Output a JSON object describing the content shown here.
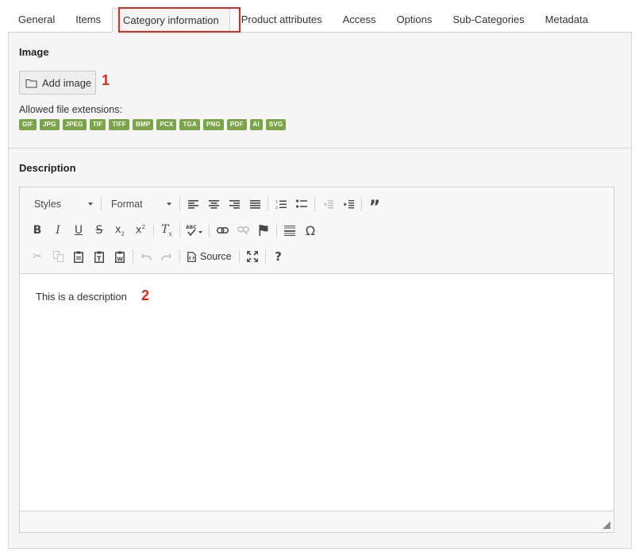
{
  "tabs": [
    {
      "label": "General"
    },
    {
      "label": "Items"
    },
    {
      "label": "Category information"
    },
    {
      "label": "Product attributes"
    },
    {
      "label": "Access"
    },
    {
      "label": "Options"
    },
    {
      "label": "Sub-Categories"
    },
    {
      "label": "Metadata"
    }
  ],
  "active_tab": "Category information",
  "image_section": {
    "title": "Image",
    "add_button_label": "Add image",
    "callout": "1",
    "allowed_label": "Allowed file extensions:",
    "extensions": [
      "GIF",
      "JPG",
      "JPEG",
      "TIF",
      "TIFF",
      "BMP",
      "PCX",
      "TGA",
      "PNG",
      "PDF",
      "AI",
      "SVG"
    ]
  },
  "description_section": {
    "title": "Description",
    "styles_label": "Styles",
    "format_label": "Format",
    "source_label": "Source",
    "content_text": "This is a description",
    "callout": "2"
  },
  "colors": {
    "badge": "#79a548",
    "highlight": "#e2281e",
    "panel": "#f5f5f5"
  }
}
